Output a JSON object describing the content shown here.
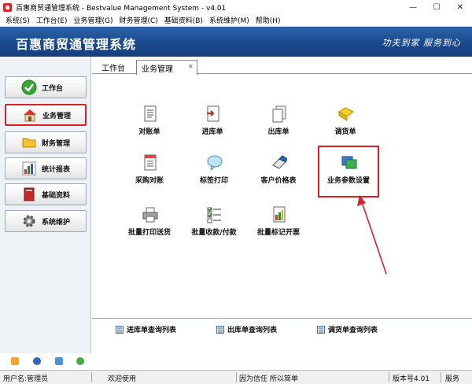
{
  "window": {
    "title": "百惠商贸通管理系统 - Bestvalue Management System - v4.01",
    "minimize": "—",
    "maximize": "☐",
    "close": "✕"
  },
  "menu": [
    "系统(S)",
    "工作台(E)",
    "业务管理(G)",
    "财务管理(C)",
    "基础资料(B)",
    "系统维护(M)",
    "帮助(H)"
  ],
  "banner": {
    "title": "百惠商贸通管理系统",
    "slogan": "功夫到家 服务到心"
  },
  "nav": [
    {
      "label": "工作台",
      "icon": "check-icon",
      "active": false
    },
    {
      "label": "业务管理",
      "icon": "house-icon",
      "active": true
    },
    {
      "label": "财务管理",
      "icon": "folder-icon",
      "active": false
    },
    {
      "label": "统计报表",
      "icon": "chart-icon",
      "active": false
    },
    {
      "label": "基础资料",
      "icon": "book-icon",
      "active": false
    },
    {
      "label": "系统维护",
      "icon": "gear-icon",
      "active": false
    }
  ],
  "tabs": {
    "home": "工作台",
    "biz": "业务管理",
    "close": "×"
  },
  "functions": [
    {
      "label": "对账单",
      "icon": "statement-doc-icon"
    },
    {
      "label": "进库单",
      "icon": "stock-in-doc-icon"
    },
    {
      "label": "出库单",
      "icon": "stock-out-doc-icon"
    },
    {
      "label": "调货单",
      "icon": "transfer-folder-icon"
    },
    {
      "label": "采购对账",
      "icon": "purchase-doc-icon"
    },
    {
      "label": "标签打印",
      "icon": "label-bubble-icon"
    },
    {
      "label": "客户价格表",
      "icon": "eraser-icon"
    },
    {
      "label": "业务参数设置",
      "icon": "params-window-icon"
    },
    {
      "label": "批量打印送货",
      "icon": "printer-icon"
    },
    {
      "label": "批量收款/付款",
      "icon": "checklist-icon"
    },
    {
      "label": "批量标记开票",
      "icon": "invoice-icon"
    }
  ],
  "quick_links": [
    "进库单查询列表",
    "出库单查询列表",
    "调货单查询列表"
  ],
  "status": {
    "user": "用户名:管理员",
    "welcome": "欢迎使用",
    "motto": "因为信任 所以简单",
    "version": "版本号4.01",
    "service": "服务"
  },
  "colors": {
    "banner": "#1a4a8e",
    "highlight": "#d6202a"
  }
}
